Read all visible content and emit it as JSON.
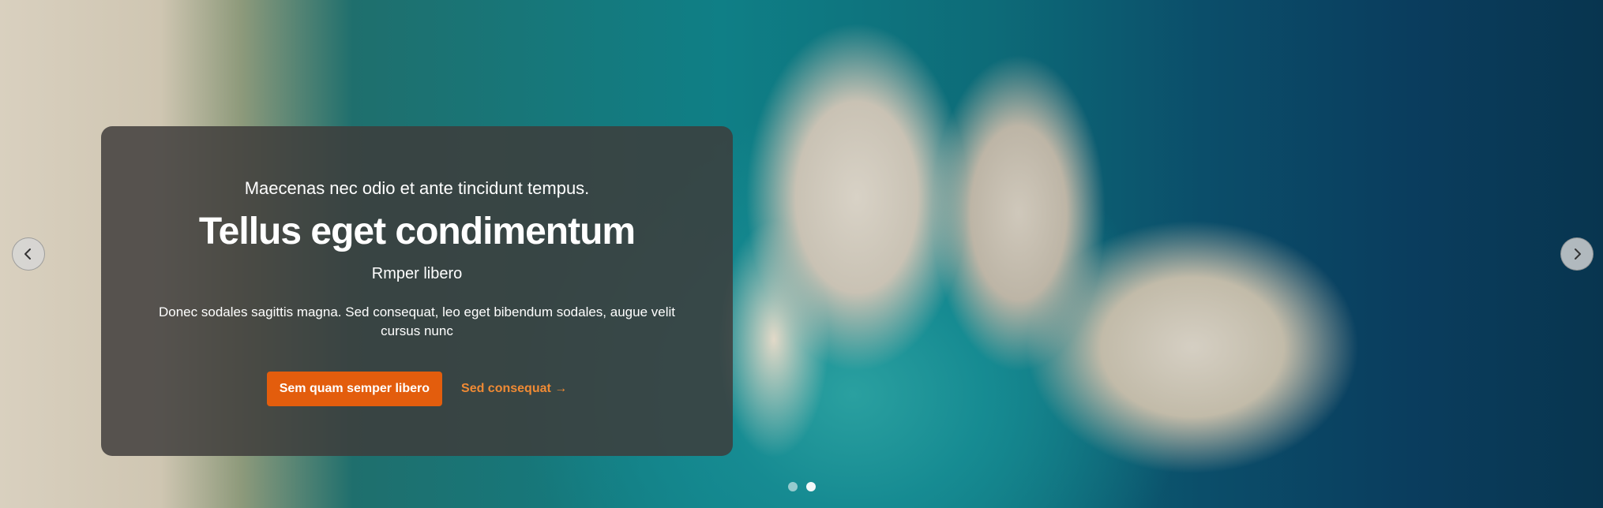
{
  "hero": {
    "eyebrow": "Maecenas nec odio et ante tincidunt tempus.",
    "title": "Tellus eget condimentum",
    "subtitle": "Rmper libero",
    "description": "Donec sodales sagittis magna. Sed consequat, leo eget bibendum sodales, augue velit cursus nunc",
    "primary_button": "Sem quam semper libero",
    "secondary_link": "Sed consequat →"
  },
  "carousel": {
    "prev_icon": "chevron-left-icon",
    "next_icon": "chevron-right-icon",
    "slide_count": 2,
    "active_slide": 1
  },
  "colors": {
    "accent": "#e35d0d",
    "link": "#f08a34",
    "overlay": "#3e3c3a"
  }
}
